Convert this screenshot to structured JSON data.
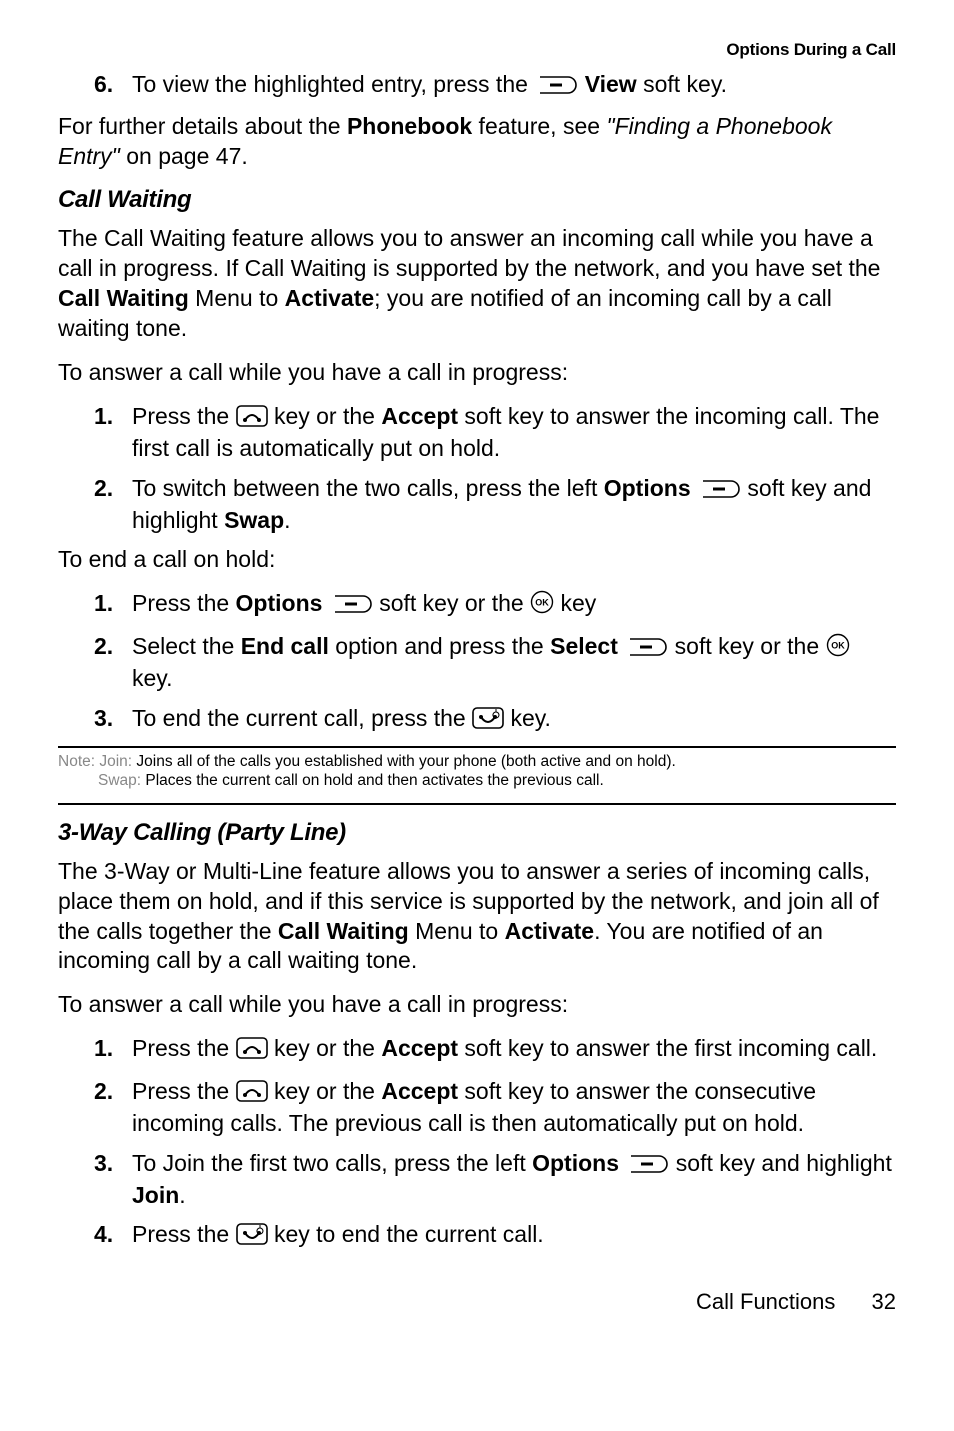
{
  "header": {
    "section": "Options During a Call"
  },
  "top_step": {
    "num": "6.",
    "prefix": "To view the highlighted entry, press the ",
    "softkey": "View",
    "suffix": " soft key."
  },
  "phonebook_para": {
    "prefix": "For further details about the ",
    "bold1": "Phonebook",
    "mid": " feature, see ",
    "ref": "\"Finding a Phonebook Entry\"",
    "suffix": " on page 47."
  },
  "call_waiting": {
    "heading": "Call Waiting",
    "intro": {
      "a": "The Call Waiting feature allows you to answer an incoming call while you have a call in progress. If Call Waiting is supported by the network, and you have set the ",
      "b": "Call Waiting",
      "c": " Menu to ",
      "d": "Activate",
      "e": "; you are notified of an incoming call by a call waiting tone."
    },
    "answer_line": "To answer a call while you have a call in progress:",
    "answer_steps": [
      {
        "num": "1.",
        "a": "Press the ",
        "b": " key or the ",
        "c": "Accept",
        "d": " soft key to answer the incoming call. The first call is automatically put on hold."
      },
      {
        "num": "2.",
        "a": "To switch between the two calls, press the left ",
        "b": "Options",
        "c": " soft key and highlight ",
        "d": "Swap",
        "e": "."
      }
    ],
    "end_line": "To end a call on hold:",
    "end_steps": [
      {
        "num": "1.",
        "a": "Press the ",
        "b": "Options",
        "c": " soft key or the ",
        "d": " key"
      },
      {
        "num": "2.",
        "a": "Select the ",
        "b": "End call",
        "c": " option and press the ",
        "d": "Select",
        "e": " soft key or the ",
        "f": " key."
      },
      {
        "num": "3.",
        "a": "To end the current call, press the ",
        "b": " key."
      }
    ]
  },
  "note": {
    "label": "Note: ",
    "join_label": "Join: ",
    "join_text": "Joins all of the calls you established with your phone (both active and on hold).",
    "swap_label": "Swap: ",
    "swap_text": "Places the current call on hold and then activates the previous call."
  },
  "three_way": {
    "heading": "3-Way Calling (Party Line)",
    "intro": {
      "a": "The 3-Way or Multi-Line feature allows you to answer a series of incoming calls, place them on hold, and if this service is supported by the network, and join all of the calls together the ",
      "b": "Call Waiting",
      "c": " Menu to ",
      "d": "Activate",
      "e": ". You are notified of an incoming call by a call waiting tone."
    },
    "answer_line": "To answer a call while you have a call in progress:",
    "steps": [
      {
        "num": "1.",
        "a": "Press the ",
        "b": " key or the ",
        "c": "Accept",
        "d": " soft key to answer the first incoming call."
      },
      {
        "num": "2.",
        "a": "Press the ",
        "b": " key or the ",
        "c": "Accept",
        "d": " soft key to answer the consecutive incoming calls. The previous call is then automatically put on hold."
      },
      {
        "num": "3.",
        "a": "To Join the first two calls, press the left ",
        "b": "Options",
        "c": " soft key and highlight ",
        "d": "Join",
        "e": "."
      },
      {
        "num": "4.",
        "a": "Press the ",
        "b": " key to end the current call."
      }
    ]
  },
  "footer": {
    "section": "Call Functions",
    "page": "32"
  }
}
